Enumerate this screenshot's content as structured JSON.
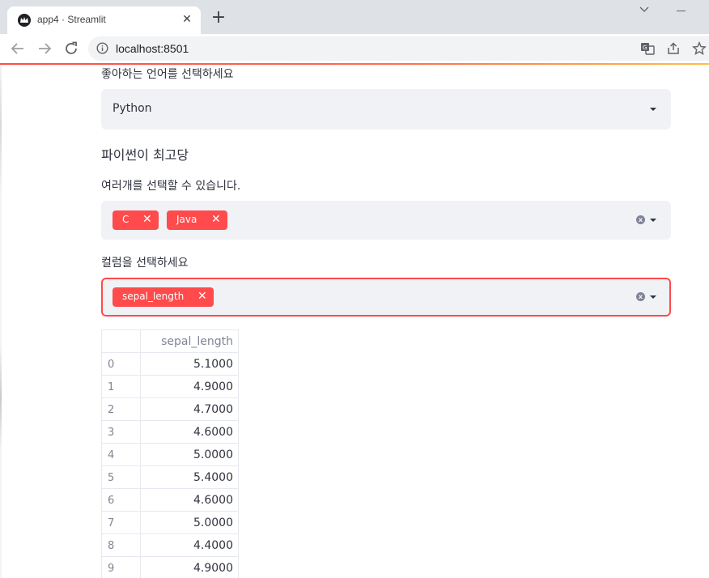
{
  "browser": {
    "tab_title": "app4 · Streamlit",
    "new_tab": "+",
    "tab_close": "✕",
    "url": "localhost:8501"
  },
  "page": {
    "language_label": "좋아하는 언어를 선택하세요",
    "language_selected": "Python",
    "python_message": "파이썬이 최고당",
    "multi_label": "여러개를 선택할 수 있습니다.",
    "multi_chips": [
      "C",
      "Java"
    ],
    "column_label": "컬럼을 선택하세요",
    "column_chips": [
      "sepal_length"
    ],
    "chip_remove": "✕",
    "clear_icon": "x"
  },
  "table": {
    "column_header": "sepal_length",
    "rows": [
      {
        "index": "0",
        "value": "5.1000"
      },
      {
        "index": "1",
        "value": "4.9000"
      },
      {
        "index": "2",
        "value": "4.7000"
      },
      {
        "index": "3",
        "value": "4.6000"
      },
      {
        "index": "4",
        "value": "5.0000"
      },
      {
        "index": "5",
        "value": "5.4000"
      },
      {
        "index": "6",
        "value": "4.6000"
      },
      {
        "index": "7",
        "value": "5.0000"
      },
      {
        "index": "8",
        "value": "4.4000"
      },
      {
        "index": "9",
        "value": "4.9000"
      }
    ]
  },
  "colors": {
    "accent": "#ff4b4b",
    "select_bg": "#f0f2f6",
    "text": "#31333f"
  },
  "icons": [
    "streamlit-crown-icon",
    "back-arrow-icon",
    "forward-arrow-icon",
    "reload-icon",
    "info-icon",
    "translate-icon",
    "share-icon",
    "star-icon",
    "chevron-down-icon",
    "clear-icon",
    "caret-down-icon"
  ]
}
